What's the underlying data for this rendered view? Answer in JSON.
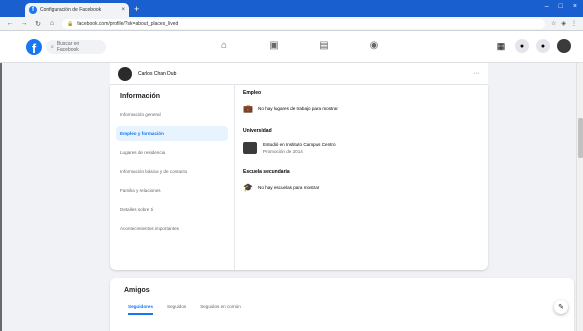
{
  "browser": {
    "tab_title": "Configuración de Facebook",
    "tab_close": "×",
    "new_tab": "+",
    "url": "facebook.com/profile/?sk=about_places_lived",
    "window_controls": [
      "–",
      "□",
      "×"
    ],
    "nav": {
      "back": "←",
      "forward": "→",
      "reload": "↻",
      "home": "⌂"
    }
  },
  "facebook": {
    "logo": "f",
    "search_placeholder": "Buscar en Facebook",
    "nav_icons": [
      "home-icon",
      "watch-icon",
      "marketplace-icon",
      "groups-icon"
    ],
    "right_icons": [
      "menu-grid-icon",
      "messenger-icon",
      "notifications-icon",
      "account-avatar"
    ]
  },
  "profile": {
    "name": "Carlos Chan Dub",
    "more": "···"
  },
  "about": {
    "title": "Información",
    "nav_items": [
      {
        "label": "Información general",
        "active": false
      },
      {
        "label": "Empleo y formación",
        "active": true
      },
      {
        "label": "Lugares de residencia",
        "active": false
      },
      {
        "label": "Información básica y de contacto",
        "active": false
      },
      {
        "label": "Familia y relaciones",
        "active": false
      },
      {
        "label": "Detalles sobre ti",
        "active": false
      },
      {
        "label": "Acontecimientos importantes",
        "active": false
      }
    ],
    "work_title": "Empleo",
    "work_empty": "No hay lugares de trabajo para mostrar",
    "edu_title": "Universidad",
    "school_name": "Estudió en Instituto Campus Centro",
    "school_sub": "Promoción de 2014",
    "hs_title": "Escuela secundaria",
    "hs_empty": "No hay escuelas para mostrar"
  },
  "friends": {
    "title": "Amigos",
    "tabs": [
      {
        "label": "Seguidores",
        "active": true
      },
      {
        "label": "Seguidos",
        "active": false
      },
      {
        "label": "Seguidos en común",
        "active": false
      }
    ],
    "fab": "✎"
  },
  "colors": {
    "brand": "#1877f2",
    "chrome": "#1a5fd0",
    "bg": "#f0f2f5"
  }
}
